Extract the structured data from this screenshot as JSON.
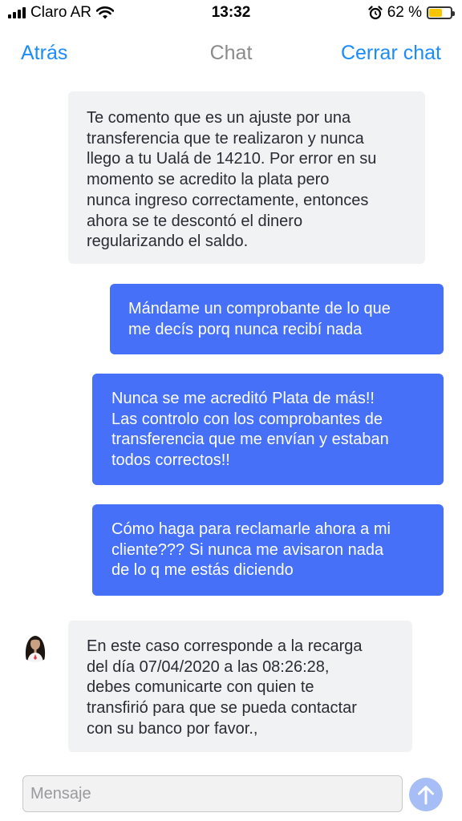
{
  "status_bar": {
    "carrier": "Claro AR",
    "time": "13:32",
    "battery_percent": "62 %",
    "battery_level": 0.62,
    "icons": [
      "signal-bars-icon",
      "wifi-icon",
      "alarm-clock-icon",
      "battery-icon"
    ],
    "battery_color": "#f7c600"
  },
  "nav": {
    "back_label": "Atrás",
    "title": "Chat",
    "close_label": "Cerrar chat",
    "accent_color": "#1a8cff"
  },
  "messages": [
    {
      "side": "in",
      "text": "Te comento que es un ajuste por una\ntransferencia que te realizaron y nunca\nllego a tu Ualá de 14210. Por error en su\nmomento se acredito la plata pero\nnunca ingreso correctamente, entonces\nahora se te descontó el dinero\nregularizando el saldo."
    },
    {
      "side": "out",
      "text": "Mándame un comprobante de lo que\nme decís porq nunca recibí nada"
    },
    {
      "side": "out",
      "text": "Nunca se me acreditó Plata de más!!\nLas controlo con los comprobantes de\ntransferencia que me envían y estaban\ntodos correctos!!"
    },
    {
      "side": "out",
      "text": "Cómo haga para reclamarle ahora a mi\ncliente??? Si nunca me avisaron nada\nde lo q me estás diciendo"
    },
    {
      "side": "in",
      "avatar": "agent-avatar",
      "text": "En este caso corresponde a la recarga\ndel día 07/04/2020 a las 08:26:28,\ndebes comunicarte con quien te\ntransfirió para que se pueda contactar\ncon su banco por favor.,"
    }
  ],
  "composer": {
    "placeholder": "Mensaje",
    "value": "",
    "send_icon": "arrow-up-icon"
  },
  "colors": {
    "incoming_bubble": "#f1f2f4",
    "outgoing_bubble": "#4570f7",
    "send_button": "#a6bdf6"
  }
}
